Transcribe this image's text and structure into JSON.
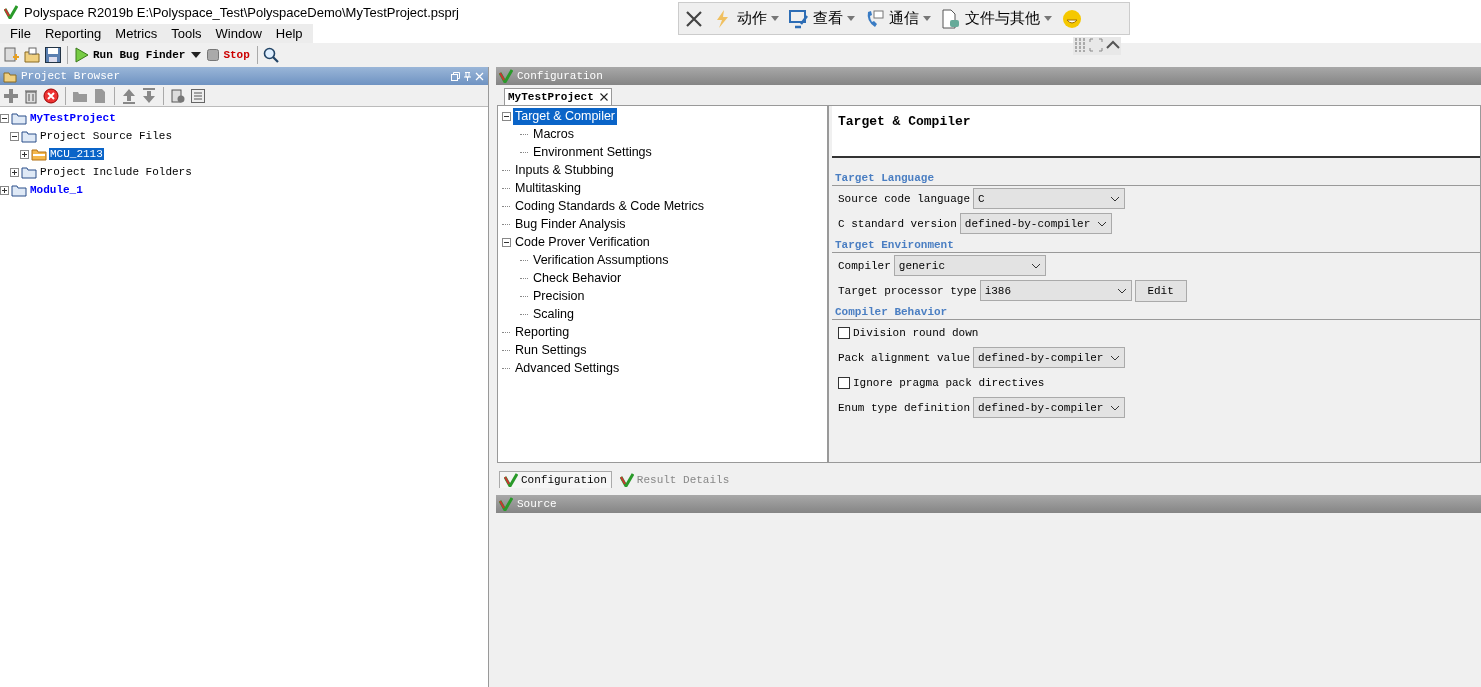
{
  "window": {
    "title": "Polyspace R2019b E:\\Polyspace_Test\\PolyspaceDemo\\MyTestProject.psprj"
  },
  "menu": [
    {
      "label": "File"
    },
    {
      "label": "Reporting"
    },
    {
      "label": "Metrics"
    },
    {
      "label": "Tools"
    },
    {
      "label": "Window"
    },
    {
      "label": "Help"
    }
  ],
  "toolbar": {
    "run_label": "Run Bug Finder",
    "stop_label": "Stop"
  },
  "remote_toolbar": {
    "items": [
      {
        "label": "动作"
      },
      {
        "label": "查看"
      },
      {
        "label": "通信"
      },
      {
        "label": "文件与其他"
      }
    ]
  },
  "project_browser": {
    "title": "Project Browser",
    "tree": [
      {
        "label": "MyTestProject",
        "kind": "project",
        "selected": false,
        "expanded": true,
        "children": [
          {
            "label": "Project Source Files",
            "kind": "folder",
            "selected": false,
            "expanded": true,
            "children": [
              {
                "label": "MCU_2113",
                "kind": "source",
                "selected": true,
                "expanded": false
              }
            ]
          },
          {
            "label": "Project Include Folders",
            "kind": "folder",
            "selected": false,
            "expanded": false
          }
        ]
      },
      {
        "label": "Module_1",
        "kind": "project",
        "selected": false,
        "expanded": false
      }
    ]
  },
  "configuration": {
    "title": "Configuration",
    "tabs": [
      {
        "label": "MyTestProject",
        "selected": true
      }
    ],
    "tree": [
      {
        "label": "Target & Compiler",
        "selected": true,
        "expanded": true,
        "children": [
          {
            "label": "Macros",
            "selected": false
          },
          {
            "label": "Environment Settings",
            "selected": false
          }
        ]
      },
      {
        "label": "Inputs & Stubbing",
        "selected": false
      },
      {
        "label": "Multitasking",
        "selected": false
      },
      {
        "label": "Coding Standards & Code Metrics",
        "selected": false
      },
      {
        "label": "Bug Finder Analysis",
        "selected": false
      },
      {
        "label": "Code Prover Verification",
        "selected": false,
        "expanded": true,
        "children": [
          {
            "label": "Verification Assumptions",
            "selected": false
          },
          {
            "label": "Check Behavior",
            "selected": false
          },
          {
            "label": "Precision",
            "selected": false
          },
          {
            "label": "Scaling",
            "selected": false
          }
        ]
      },
      {
        "label": "Reporting",
        "selected": false
      },
      {
        "label": "Run Settings",
        "selected": false
      },
      {
        "label": "Advanced Settings",
        "selected": false
      }
    ],
    "heading": "Target & Compiler",
    "sections": [
      {
        "title": "Target Language",
        "rows": [
          {
            "kind": "select",
            "label": "Source code language",
            "value": "C"
          },
          {
            "kind": "select",
            "label": "C standard version",
            "value": "defined-by-compiler"
          }
        ]
      },
      {
        "title": "Target Environment",
        "rows": [
          {
            "kind": "select",
            "label": "Compiler",
            "value": "generic"
          },
          {
            "kind": "select",
            "label": "Target processor type",
            "value": "i386",
            "button": "Edit"
          }
        ]
      },
      {
        "title": "Compiler Behavior",
        "rows": [
          {
            "kind": "checkbox",
            "label": "Division round down",
            "checked": false
          },
          {
            "kind": "select",
            "label": "Pack alignment value",
            "value": "defined-by-compiler"
          },
          {
            "kind": "checkbox",
            "label": "Ignore pragma pack directives",
            "checked": false
          },
          {
            "kind": "select",
            "label": "Enum type definition",
            "value": "defined-by-compiler"
          }
        ]
      }
    ]
  },
  "bottom_tabs": [
    {
      "label": "Configuration",
      "selected": true
    },
    {
      "label": "Result Details",
      "selected": false
    }
  ],
  "source": {
    "title": "Source"
  }
}
